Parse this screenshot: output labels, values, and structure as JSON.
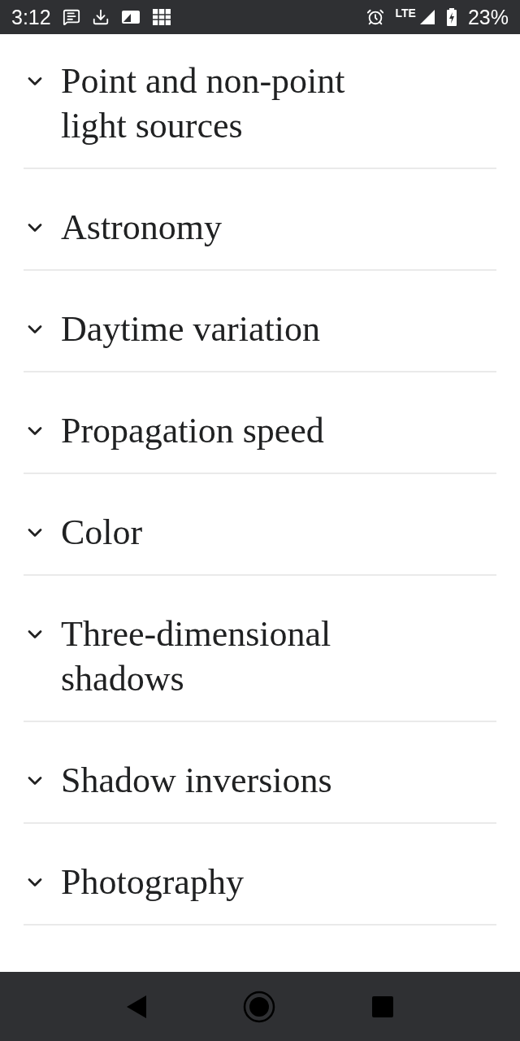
{
  "status_bar": {
    "time": "3:12",
    "network": "LTE",
    "battery": "23%"
  },
  "sections": [
    {
      "title": "Point and non-point light sources",
      "expanded": false
    },
    {
      "title": "Astronomy",
      "expanded": false
    },
    {
      "title": "Daytime variation",
      "expanded": false
    },
    {
      "title": "Propagation speed",
      "expanded": false
    },
    {
      "title": "Color",
      "expanded": false
    },
    {
      "title": "Three-dimensional shadows",
      "expanded": false
    },
    {
      "title": "Shadow inversions",
      "expanded": false
    },
    {
      "title": "Photography",
      "expanded": false
    }
  ]
}
